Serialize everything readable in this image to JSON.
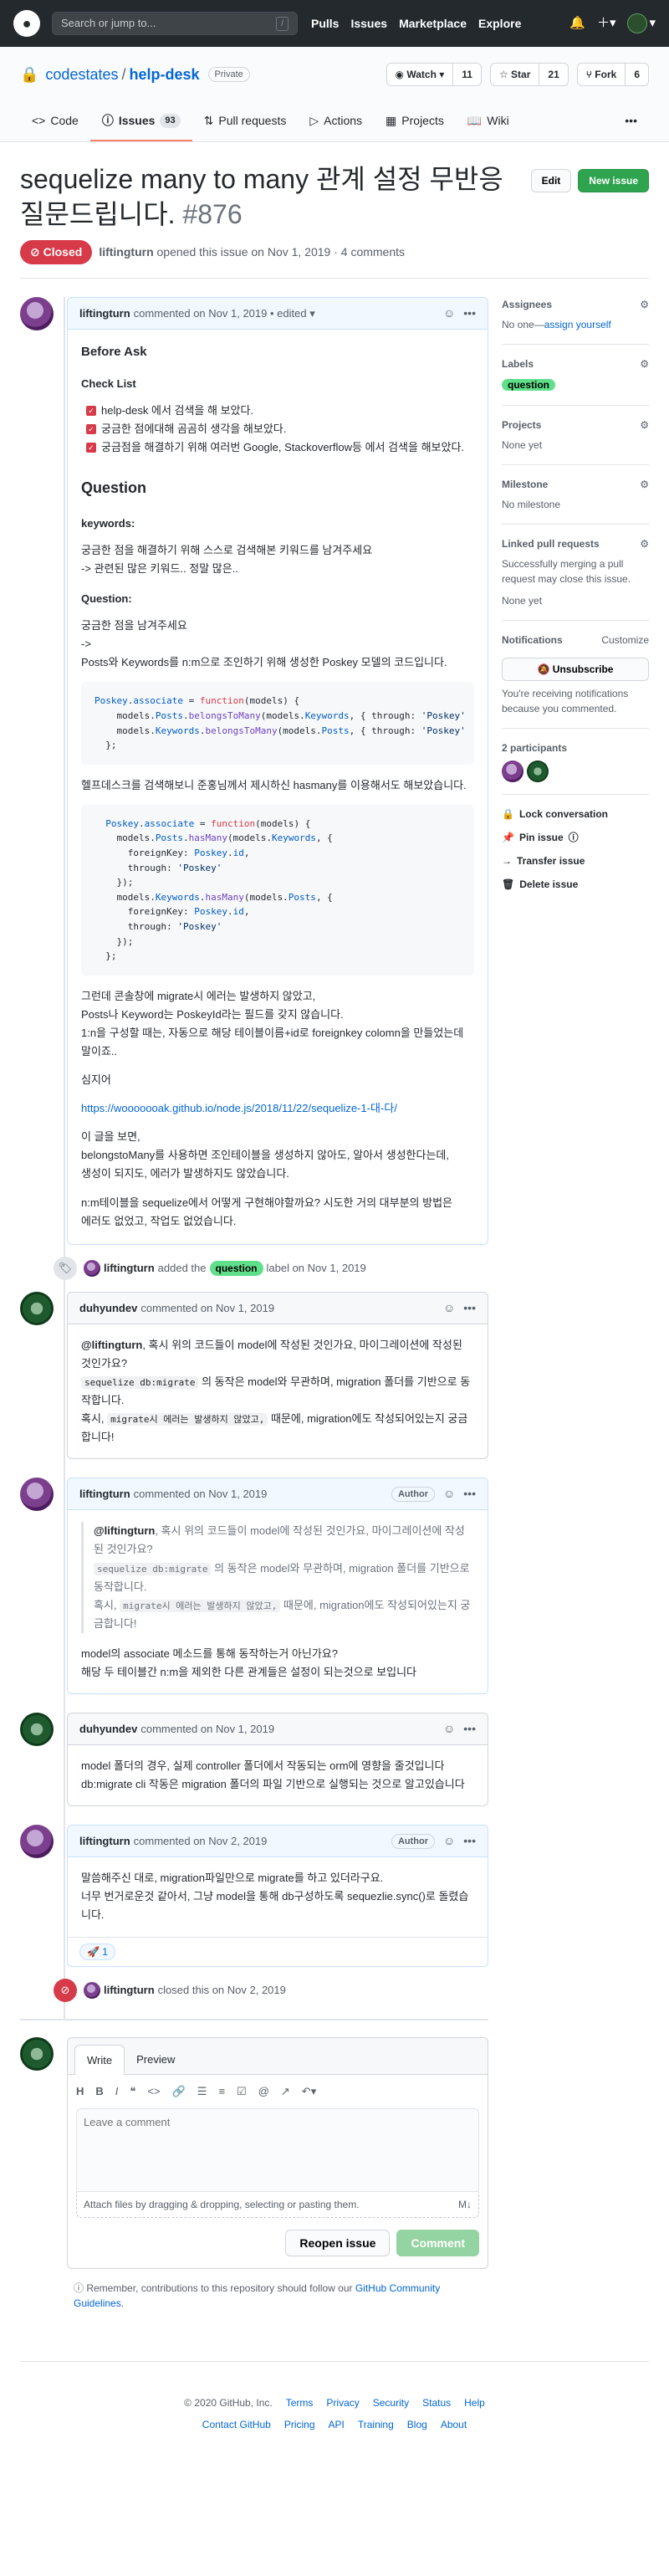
{
  "header": {
    "search_placeholder": "Search or jump to...",
    "search_key": "/",
    "nav": [
      "Pulls",
      "Issues",
      "Marketplace",
      "Explore"
    ]
  },
  "repo": {
    "owner": "codestates",
    "name": "help-desk",
    "visibility": "Private",
    "watch": "Watch",
    "watch_count": "11",
    "star": "Star",
    "star_count": "21",
    "fork": "Fork",
    "fork_count": "6"
  },
  "tabs": [
    {
      "label": "Code"
    },
    {
      "label": "Issues",
      "count": "93"
    },
    {
      "label": "Pull requests"
    },
    {
      "label": "Actions"
    },
    {
      "label": "Projects"
    },
    {
      "label": "Wiki"
    }
  ],
  "issue": {
    "title": "sequelize many to many 관계 설정 무반응 질문드립니다.",
    "number": "#876",
    "edit": "Edit",
    "new_issue": "New issue",
    "state": "Closed",
    "author": "liftingturn",
    "meta": "opened this issue on Nov 1, 2019 · 4 comments"
  },
  "c1": {
    "author": "liftingturn",
    "date": "commented on Nov 1, 2019",
    "edited": "• edited ▾",
    "before_ask": "Before Ask",
    "checklist": "Check List",
    "tasks": [
      "help-desk 에서 검색을 해 보았다.",
      "궁금한 점에대해 곰곰히 생각을 해보았다.",
      "궁금점을 해결하기 위해 여러번 Google, Stackoverflow등 에서 검색을 해보았다."
    ],
    "question_h": "Question",
    "keywords_h": "keywords:",
    "kw1": "궁금한 점을 해결하기 위해 스스로 검색해본 키워드를 남겨주세요",
    "kw2": "-> 관련된 많은 키워드.. 정말 많은..",
    "question_sub": "Question:",
    "q1": "궁금한 점을 남겨주세요",
    "q2": "->",
    "q3": "Posts와 Keywords를 n:m으로 조인하기 위해 생성한 Poskey 모델의 코드입니다.",
    "p2": "헬프데스크를 검색해보니 준홍님께서 제시하신 hasmany를 이용해서도 해보았습니다.",
    "p3a": "그런데 콘솔창에 migrate시 에러는 발생하지 않았고,",
    "p3b": "Posts나 Keyword는 PoskeyId라는 필드를 갖지 않습니다.",
    "p3c": "1:n을 구성할 때는, 자동으로 해당 테이블이름+id로 foreignkey colomn을 만들었는데 말이죠..",
    "p4": "심지어",
    "link": "https://wooooooak.github.io/node.js/2018/11/22/sequelize-1-대-다/",
    "p5a": "이 글을 보면,",
    "p5b": "belongstoMany를 사용하면 조인테이블을 생성하지 않아도, 알아서 생성한다는데,",
    "p5c": "생성이 되지도, 에러가 발생하지도 않았습니다.",
    "p6a": "n:m테이블을 sequelize에서 어떻게 구현해야할까요? 시도한 거의 대부분의 방법은",
    "p6b": "에러도 없었고, 작업도 없었습니다."
  },
  "ev1": {
    "author": "liftingturn",
    "pre": "added the",
    "label": "question",
    "post": "label on Nov 1, 2019"
  },
  "c2": {
    "author": "duhyundev",
    "date": "commented on Nov 1, 2019",
    "mention": "@liftingturn",
    "t1": ", 혹시 위의 코드들이 model에 작성된 것인가요, 마이그레이션에 작성된 것인가요?",
    "code1": "sequelize db:migrate",
    "t2": "의 동작은 model와 무관하며, migration 폴더를 기반으로 동작합니다.",
    "t3": "혹시,",
    "code2": "migrate시 에러는 발생하지 않았고,",
    "t4": "때문에, migration에도 작성되어있는지 궁금합니다!"
  },
  "c3": {
    "author": "liftingturn",
    "date": "commented on Nov 1, 2019",
    "badge": "Author",
    "r1": "model의 associate 메소드를 통해 동작하는거 아닌가요?",
    "r2": "해당 두 테이블간 n:m을 제외한 다른 관계들은 설정이 되는것으로 보입니다"
  },
  "c4": {
    "author": "duhyundev",
    "date": "commented on Nov 1, 2019",
    "r1": "model 폴더의 경우, 실제 controller 폴더에서 작동되는 orm에 영향을 줄것입니다",
    "r2": "db:migrate cli 작동은 migration 폴더의 파일 기반으로 실행되는 것으로 알고있습니다"
  },
  "c5": {
    "author": "liftingturn",
    "date": "commented on Nov 2, 2019",
    "badge": "Author",
    "r1": "말씀해주신 대로, migration파일만으로 migrate를 하고 있더라구요.",
    "r2": "너무 번거로운것 같아서, 그냥 model을 통해 db구성하도록 sequezlie.sync()로 돌렸습니다.",
    "reaction": "🚀 1"
  },
  "ev2": {
    "author": "liftingturn",
    "text": "closed this on Nov 2, 2019"
  },
  "newcomment": {
    "write": "Write",
    "preview": "Preview",
    "placeholder": "Leave a comment",
    "attach": "Attach files by dragging & dropping, selecting or pasting them.",
    "md": "M↓",
    "reopen": "Reopen issue",
    "comment": "Comment"
  },
  "tip": {
    "text": "Remember, contributions to this repository should follow our",
    "link": "GitHub Community Guidelines",
    "end": "."
  },
  "sidebar": {
    "assignees": "Assignees",
    "assignees_v": "No one—",
    "assign_self": "assign yourself",
    "labels": "Labels",
    "label_v": "question",
    "projects": "Projects",
    "projects_v": "None yet",
    "milestone": "Milestone",
    "milestone_v": "No milestone",
    "linked": "Linked pull requests",
    "linked_desc": "Successfully merging a pull request may close this issue.",
    "linked_v": "None yet",
    "notif": "Notifications",
    "customize": "Customize",
    "unsub": "Unsubscribe",
    "notif_desc": "You're receiving notifications because you commented.",
    "participants": "2 participants",
    "lock": "Lock conversation",
    "pin": "Pin issue",
    "transfer": "Transfer issue",
    "delete": "Delete issue"
  },
  "footer": {
    "copy": "© 2020 GitHub, Inc.",
    "row1": [
      "Terms",
      "Privacy",
      "Security",
      "Status",
      "Help"
    ],
    "row2": [
      "Contact GitHub",
      "Pricing",
      "API",
      "Training",
      "Blog",
      "About"
    ]
  },
  "colors": {
    "closed": "#d73a49",
    "green": "#2ea44f",
    "label": "#5fdf89"
  }
}
